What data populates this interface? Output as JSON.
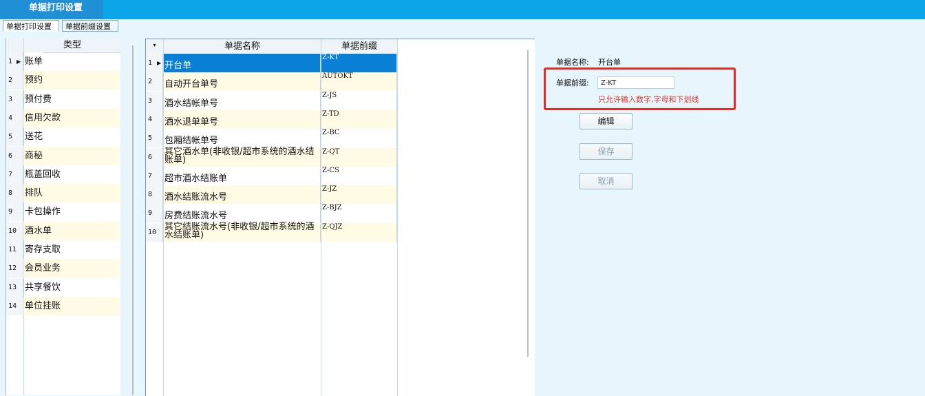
{
  "window": {
    "title": "单据打印设置"
  },
  "tabs": [
    {
      "label": "单据打印设置"
    },
    {
      "label": "单据前缀设置"
    }
  ],
  "type_grid": {
    "column_header": "类型",
    "rows": [
      {
        "num": "1",
        "label": "账单"
      },
      {
        "num": "2",
        "label": "预约"
      },
      {
        "num": "3",
        "label": "预付费"
      },
      {
        "num": "4",
        "label": "信用欠款"
      },
      {
        "num": "5",
        "label": "送花"
      },
      {
        "num": "6",
        "label": "商秘"
      },
      {
        "num": "7",
        "label": "瓶盖回收"
      },
      {
        "num": "8",
        "label": "排队"
      },
      {
        "num": "9",
        "label": "卡包操作"
      },
      {
        "num": "10",
        "label": "酒水单"
      },
      {
        "num": "11",
        "label": "寄存支取"
      },
      {
        "num": "12",
        "label": "会员业务"
      },
      {
        "num": "13",
        "label": "共享餐饮"
      },
      {
        "num": "14",
        "label": "单位挂账"
      }
    ]
  },
  "doc_grid": {
    "headers": {
      "name": "单据名称",
      "prefix": "单据前缀"
    },
    "rows": [
      {
        "num": "1",
        "name": "开台单",
        "prefix": "Z-KT"
      },
      {
        "num": "2",
        "name": "自动开台单号",
        "prefix": "AUTOKT"
      },
      {
        "num": "3",
        "name": "酒水结帐单号",
        "prefix": "Z-JS"
      },
      {
        "num": "4",
        "name": "酒水退单单号",
        "prefix": "Z-TD"
      },
      {
        "num": "5",
        "name": "包厢结帐单号",
        "prefix": "Z-BC"
      },
      {
        "num": "6",
        "name": "其它酒水单(非收银/超市系统的酒水结账单)",
        "prefix": "Z-QT"
      },
      {
        "num": "7",
        "name": "超市酒水结账单",
        "prefix": "Z-CS"
      },
      {
        "num": "8",
        "name": "酒水结账流水号",
        "prefix": "Z-JZ"
      },
      {
        "num": "9",
        "name": "房费结账流水号",
        "prefix": "Z-BJZ"
      },
      {
        "num": "10",
        "name": "其它结账流水号(非收银/超市系统的酒水结账单)",
        "prefix": "Z-QJZ"
      }
    ]
  },
  "detail": {
    "doc_name_label": "单据名称:",
    "doc_name_value": "开台单",
    "prefix_label": "单据前缀:",
    "prefix_value": "Z-KT",
    "hint": "只允许输入数字,字母和下划线",
    "hint_color": "#e0332e",
    "highlight_color": "#e62b23"
  },
  "buttons": {
    "edit": "编辑",
    "save": "保存",
    "cancel": "取消"
  },
  "colors": {
    "titlebar": "#0ba6ea",
    "selection": "#0a7fd6",
    "background": "#e6f6fc"
  }
}
